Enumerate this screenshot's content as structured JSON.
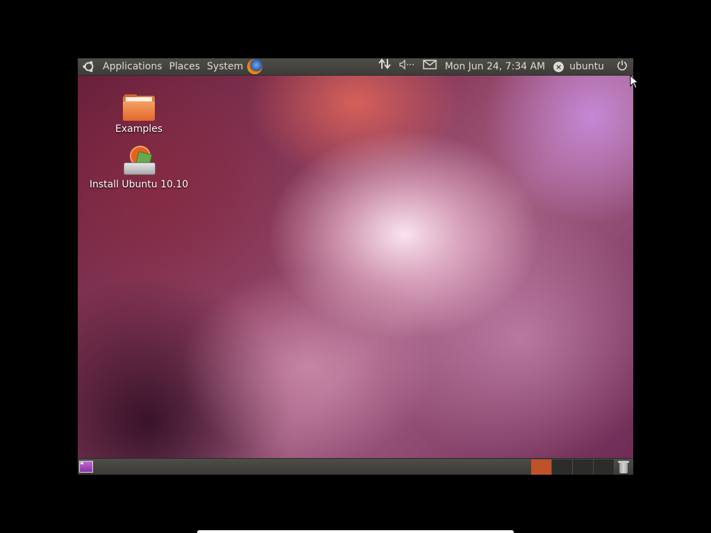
{
  "top_panel": {
    "menus": [
      "Applications",
      "Places",
      "System"
    ],
    "clock": "Mon Jun 24,  7:34 AM",
    "user": "ubuntu",
    "network_icon": "network-arrows-icon",
    "volume_icon": "volume-icon",
    "mail_icon": "mail-icon",
    "power_icon": "power-icon"
  },
  "desktop": {
    "icons": [
      {
        "label": "Examples",
        "icon": "folder-icon"
      },
      {
        "label": "Install Ubuntu 10.10",
        "icon": "installer-icon"
      }
    ]
  },
  "bottom_panel": {
    "workspaces": 4,
    "active_workspace": 1
  },
  "colors": {
    "panel": "#3d3c38",
    "panel_text": "#dfdbd2",
    "active_workspace": "#c0522a"
  }
}
